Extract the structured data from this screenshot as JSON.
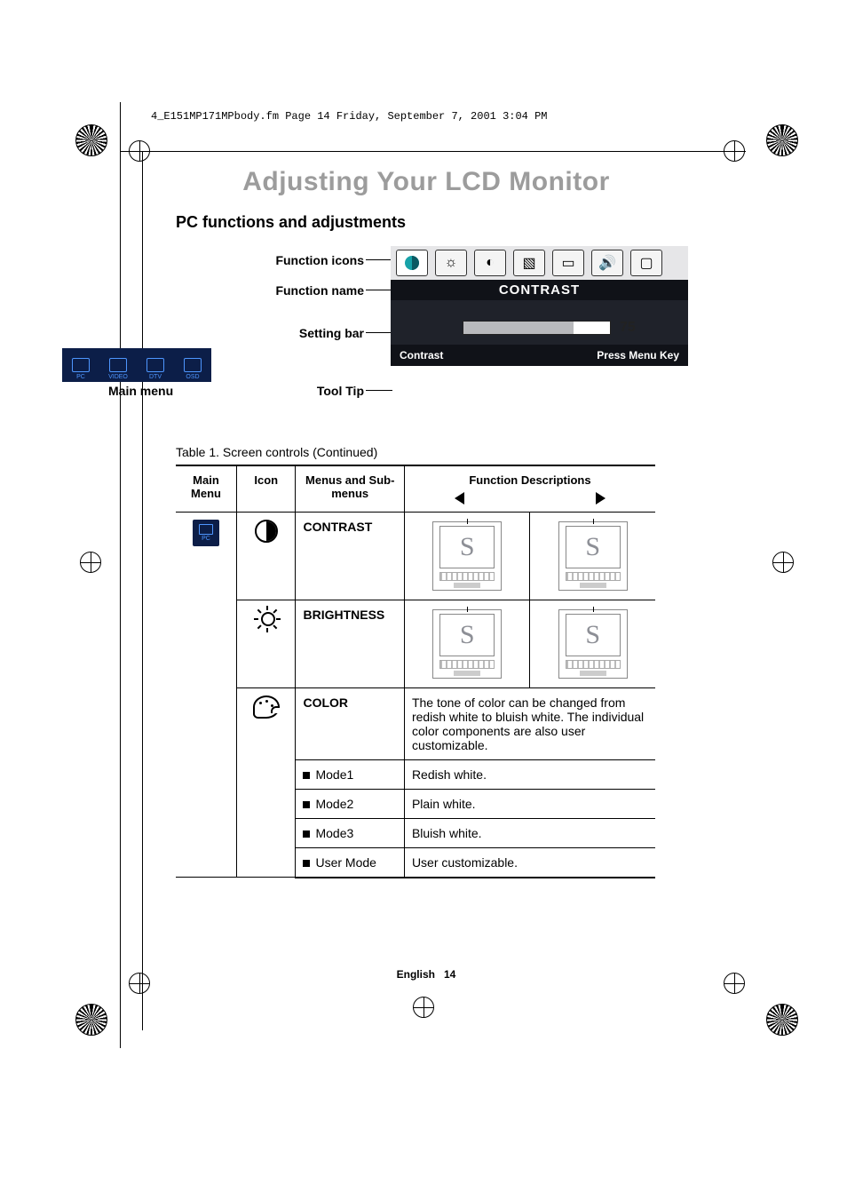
{
  "fm_header": "4_E151MP171MPbody.fm  Page 14  Friday, September 7, 2001  3:04 PM",
  "title": "Adjusting Your LCD Monitor",
  "section": "PC functions and adjustments",
  "diagram": {
    "labels": {
      "icons": "Function icons",
      "name": "Function name",
      "bar": "Setting bar",
      "tooltip": "Tool Tip",
      "mainmenu": "Main menu"
    },
    "osd": {
      "function_name": "CONTRAST",
      "value": "75",
      "tooltip_left": "Contrast",
      "tooltip_right": "Press Menu Key"
    },
    "mainmenu_items": [
      "PC",
      "VIDEO",
      "DTV",
      "OSD"
    ]
  },
  "table": {
    "caption": "Table 1.  Screen controls (Continued)",
    "headers": {
      "main_menu": "Main Menu",
      "icon": "Icon",
      "menus": "Menus and Sub-menus",
      "desc": "Function Descriptions"
    },
    "rows": {
      "pc_label": "PC",
      "contrast": "CONTRAST",
      "brightness": "BRIGHTNESS",
      "color": "COLOR",
      "color_desc": "The tone of color can be changed from redish white to bluish white. The individual color components are also user customizable.",
      "mode1": "Mode1",
      "mode1_desc": "Redish white.",
      "mode2": "Mode2",
      "mode2_desc": "Plain white.",
      "mode3": "Mode3",
      "mode3_desc": "Bluish white.",
      "usermode": "User Mode",
      "usermode_desc": "User customizable."
    }
  },
  "footer": {
    "lang": "English",
    "page": "14"
  },
  "chart_data": {
    "type": "table",
    "title": "Screen controls (Continued)",
    "columns": [
      "Main Menu",
      "Icon",
      "Menus and Sub-menus",
      "Function Descriptions"
    ],
    "rows": [
      [
        "PC",
        "half-moon",
        "CONTRAST",
        "decrease / increase contrast illustration"
      ],
      [
        "PC",
        "sun",
        "BRIGHTNESS",
        "decrease / increase brightness illustration"
      ],
      [
        "PC",
        "palette",
        "COLOR",
        "The tone of color can be changed from redish white to bluish white. The individual color components are also user customizable."
      ],
      [
        "PC",
        "",
        "Mode1",
        "Redish white."
      ],
      [
        "PC",
        "",
        "Mode2",
        "Plain white."
      ],
      [
        "PC",
        "",
        "Mode3",
        "Bluish white."
      ],
      [
        "PC",
        "",
        "User Mode",
        "User customizable."
      ]
    ],
    "osd_example": {
      "function": "CONTRAST",
      "value": 75
    }
  }
}
